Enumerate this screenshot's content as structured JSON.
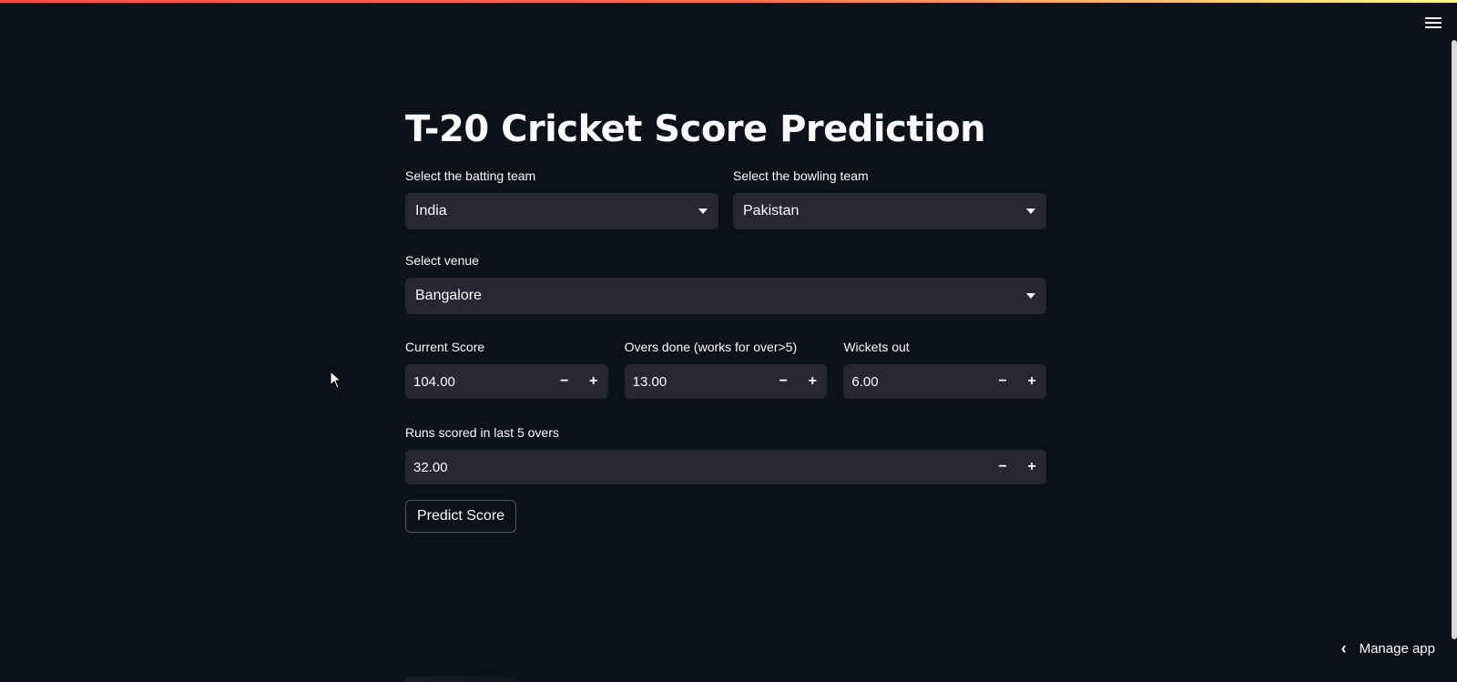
{
  "app": {
    "title": "T-20 Cricket Score Prediction"
  },
  "batting": {
    "label": "Select the batting team",
    "value": "India"
  },
  "bowling": {
    "label": "Select the bowling team",
    "value": "Pakistan"
  },
  "venue": {
    "label": "Select venue",
    "value": "Bangalore"
  },
  "current_score": {
    "label": "Current Score",
    "value": "104.00"
  },
  "overs": {
    "label": "Overs done (works for over>5)",
    "value": "13.00"
  },
  "wickets": {
    "label": "Wickets out",
    "value": "6.00"
  },
  "last_five": {
    "label": "Runs scored in last 5 overs",
    "value": "32.00"
  },
  "stepper": {
    "minus": "−",
    "plus": "+"
  },
  "actions": {
    "predict_label": "Predict Score"
  },
  "manage": {
    "chevron": "‹",
    "label": "Manage app"
  },
  "colors": {
    "background": "#0e1117",
    "input_bg": "#262730",
    "accent_red": "#ff4b4b",
    "accent_yellow": "#fffd80"
  },
  "icons": {
    "menu": "hamburger-menu-icon",
    "dropdown": "chevron-down-icon",
    "back": "chevron-left-icon",
    "cursor": "mouse-pointer-icon"
  }
}
